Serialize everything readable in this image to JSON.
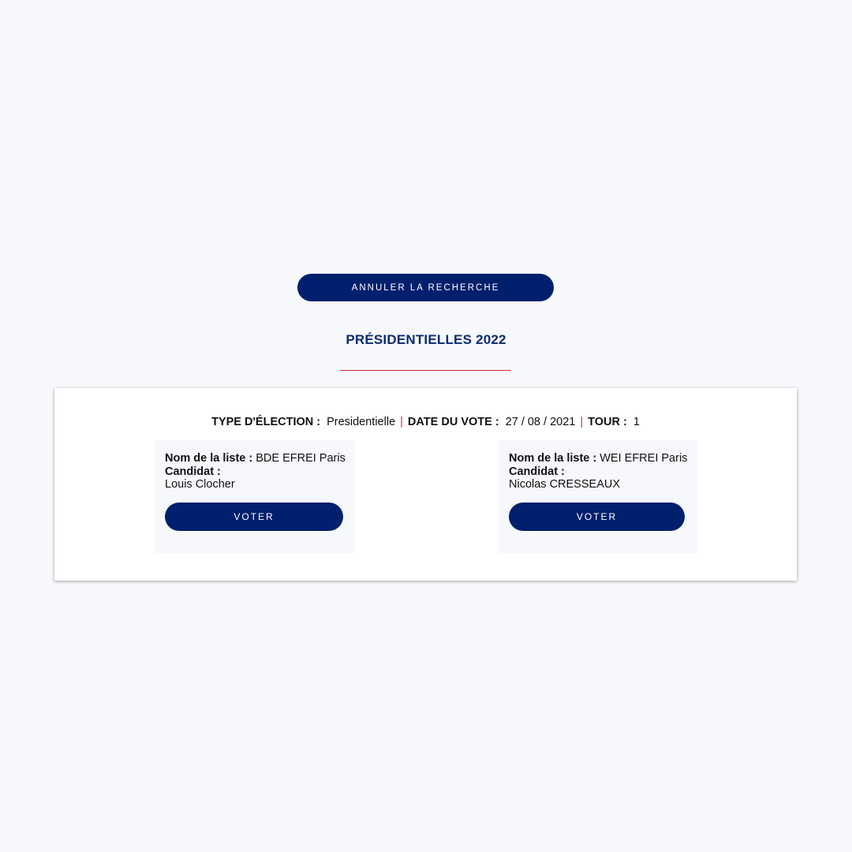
{
  "search": {
    "cancel_label": "ANNULER LA RECHERCHE"
  },
  "election": {
    "title": "PRÉSIDENTIELLES 2022",
    "type_label": "TYPE D'ÉLECTION :",
    "type_value": "Presidentielle",
    "date_label": "DATE DU VOTE :",
    "date_value": "27 / 08 / 2021",
    "round_label": "TOUR :",
    "round_value": "1",
    "separator": "|"
  },
  "candidates": [
    {
      "list_label": "Nom de la liste :",
      "list_name": "BDE EFREI Paris",
      "candidate_label": "Candidat :",
      "candidate_name": "Louis Clocher",
      "vote_label": "VOTER"
    },
    {
      "list_label": "Nom de la liste :",
      "list_name": "WEI EFREI Paris",
      "candidate_label": "Candidat :",
      "candidate_name": "Nicolas CRESSEAUX",
      "vote_label": "VOTER"
    }
  ],
  "colors": {
    "primary": "#001f6d",
    "title": "#0d2b73",
    "accent": "#d6303f",
    "background": "#f6f8fc"
  }
}
